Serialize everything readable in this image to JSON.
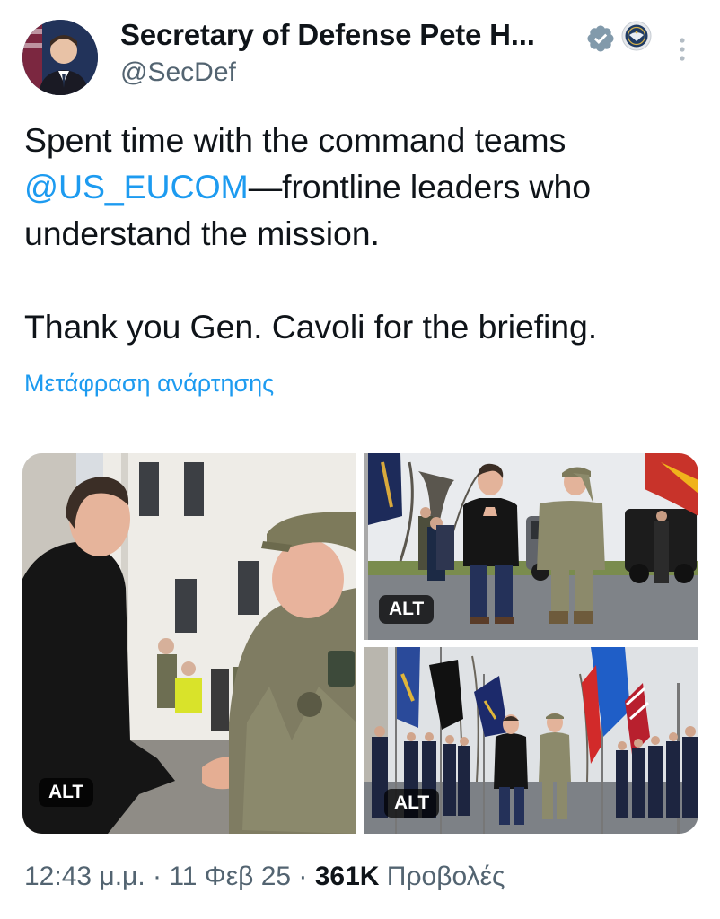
{
  "author": {
    "display_name": "Secretary of Defense Pete H...",
    "handle": "@SecDef",
    "avatar_icon": "profile-photo",
    "verified_icon": "verified-badge-icon",
    "affiliation_icon": "dod-seal-icon",
    "verified_color": "#829aab"
  },
  "tweet": {
    "line1": "Spent time with the command teams ",
    "mention": "@US_EUCOM",
    "line2": "—frontline leaders who understand the mission.\n\nThank you Gen. Cavoli for the briefing.",
    "translate_label": "Μετάφραση ανάρτησης"
  },
  "media": {
    "photos": [
      {
        "alt_label": "ALT",
        "description_icon": "handshake-photo"
      },
      {
        "alt_label": "ALT",
        "description_icon": "salute-photo"
      },
      {
        "alt_label": "ALT",
        "description_icon": "honor-guard-photo"
      }
    ]
  },
  "meta": {
    "time": "12:43 μ.μ.",
    "sep1": " · ",
    "date": "11 Φεβ 25",
    "sep2": " · ",
    "views_count": "361K",
    "views_label": " Προβολές"
  },
  "colors": {
    "link": "#1d9bf0",
    "secondary": "#536471",
    "text": "#0f1419"
  }
}
